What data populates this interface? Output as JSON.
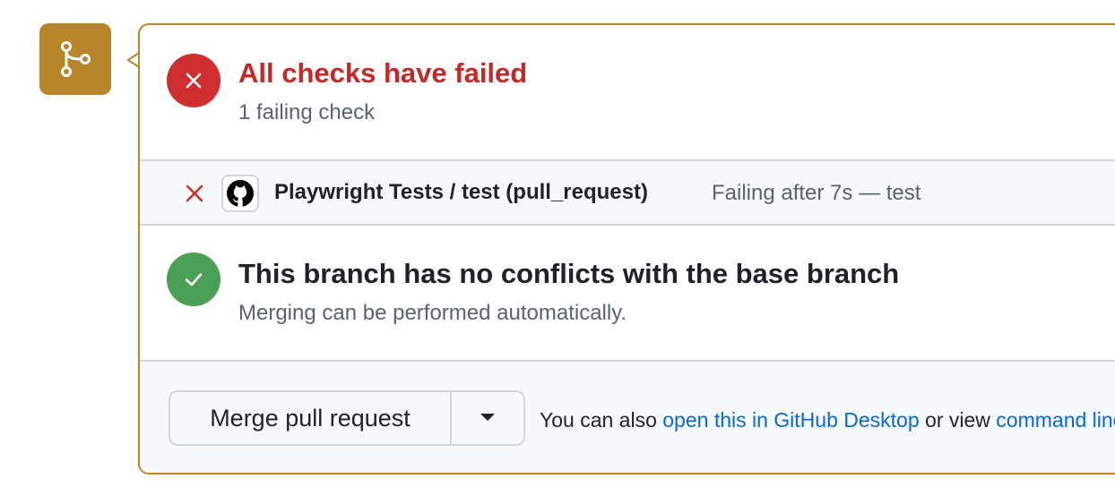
{
  "colors": {
    "merge_icon_bg": "#b8862a",
    "failed_red": "#cf2f2f",
    "success_green": "#4c9f56",
    "link_blue": "#0969da"
  },
  "merge_icon": {
    "icon": "git-branch-icon"
  },
  "checks_summary": {
    "status_icon": "x-circle-icon",
    "title": "All checks have failed",
    "subtitle": "1 failing check"
  },
  "check_item": {
    "status_icon": "x-icon",
    "avatar_icon": "github-logo-icon",
    "name": "Playwright Tests / test (pull_request)",
    "status_text": "Failing after 7s — test"
  },
  "conflicts": {
    "status_icon": "check-circle-icon",
    "title": "This branch has no conflicts with the base branch",
    "subtitle": "Merging can be performed automatically."
  },
  "merge": {
    "button_label": "Merge pull request",
    "dropdown_icon": "triangle-down-icon",
    "also_text_1": "You can also",
    "link_desktop": "open this in GitHub Desktop",
    "also_text_2": "or view",
    "link_command": "command line instructions."
  }
}
